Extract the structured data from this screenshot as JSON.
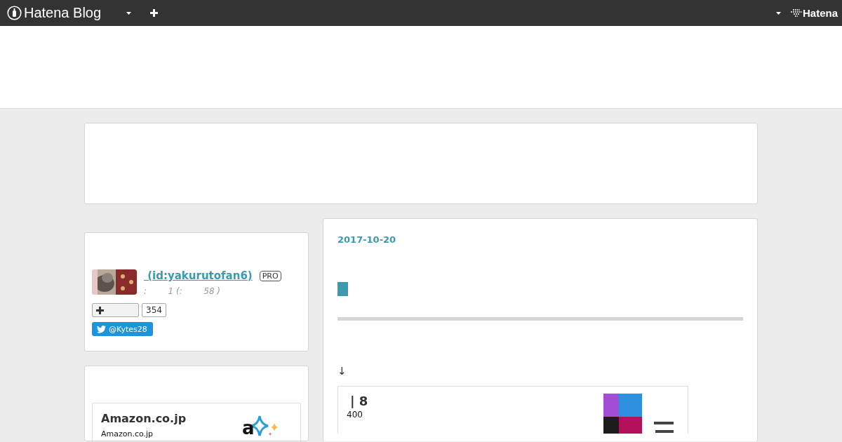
{
  "navbar": {
    "logo": "Hatena Blog",
    "brand": "Hatena"
  },
  "profile": {
    "name": " (id:yakurutofan6)",
    "badge": "PRO",
    "stats": ":        1 (:        58 )",
    "bookmark_count": "354",
    "twitter": "@Kytes28"
  },
  "amazon": {
    "title": "Amazon.co.jp",
    "subtitle": "Amazon.co.jp",
    "logo_text": "a"
  },
  "entry": {
    "date": "2017-10-20",
    "arrow": "↓",
    "embed": {
      "title": "| 8",
      "subtitle": "400"
    }
  }
}
